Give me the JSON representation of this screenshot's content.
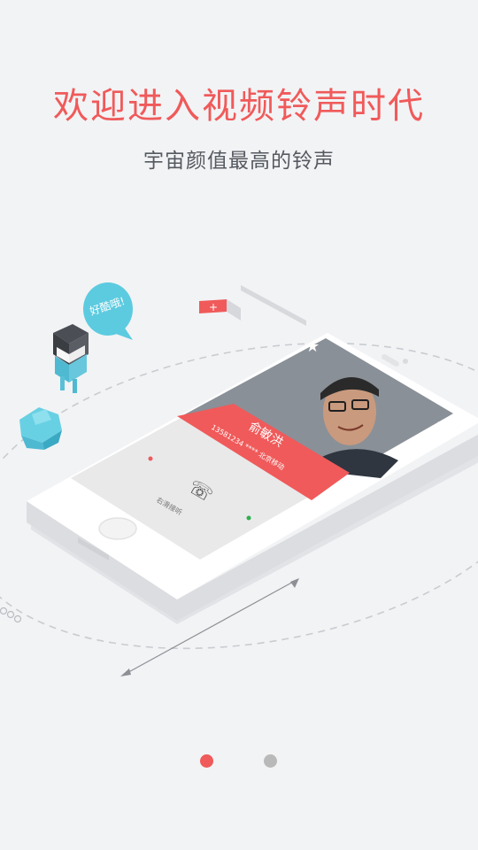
{
  "onboarding": {
    "title": "欢迎进入视频铃声时代",
    "subtitle": "宇宙颜值最高的铃声",
    "page_total": 2,
    "page_current": 1
  },
  "illustration": {
    "speech_bubble_text": "好酷哦!",
    "caller_name": "俞敏洪",
    "caller_info": "13581234 **** 北京移动",
    "reject_label": "右滑接听"
  },
  "colors": {
    "accent": "#f05a5a",
    "muted_dot": "#b9b9b9",
    "cyan": "#5ccbe0",
    "green": "#2bb24c"
  },
  "icons": [
    "star-icon",
    "phone-handset-icon",
    "close-icon",
    "plus-icon"
  ]
}
